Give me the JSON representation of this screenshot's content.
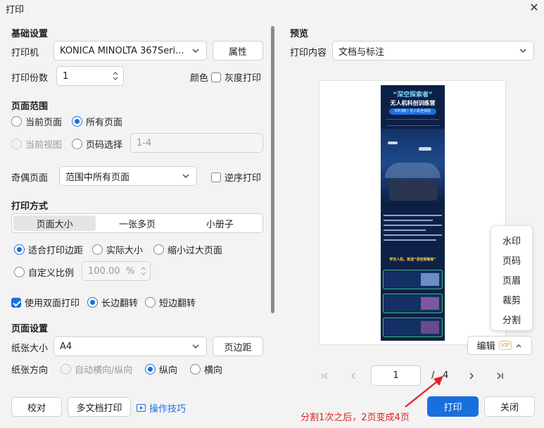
{
  "window": {
    "title": "打印"
  },
  "basic": {
    "section": "基础设置",
    "printer_label": "打印机",
    "printer_value": "KONICA MINOLTA 367Seri...",
    "properties_button": "属性",
    "copies_label": "打印份数",
    "copies_value": "1",
    "color_label": "颜色",
    "grayscale_label": "灰度打印"
  },
  "page_range": {
    "section": "页面范围",
    "current_page": "当前页面",
    "all_pages": "所有页面",
    "current_view": "当前视图",
    "page_select": "页码选择",
    "page_select_value": "1-4",
    "odd_even_label": "奇偶页面",
    "odd_even_value": "范围中所有页面",
    "reverse_label": "逆序打印"
  },
  "print_mode": {
    "section": "打印方式",
    "tabs": [
      "页面大小",
      "一张多页",
      "小册子"
    ],
    "fit_margin": "适合打印边距",
    "actual_size": "实际大小",
    "shrink_large": "缩小过大页面",
    "custom_scale": "自定义比例",
    "custom_scale_value": "100.00",
    "custom_scale_unit": "%",
    "duplex": "使用双面打印",
    "long_edge": "长边翻转",
    "short_edge": "短边翻转"
  },
  "page_setup": {
    "section": "页面设置",
    "paper_size_label": "纸张大小",
    "paper_size_value": "A4",
    "margins_button": "页边距",
    "orientation_label": "纸张方向",
    "auto_orientation": "自动横向/纵向",
    "portrait": "纵向",
    "landscape": "横向"
  },
  "footer": {
    "proofread": "校对",
    "multi_doc": "多文档打印",
    "tips": "操作技巧",
    "print": "打印",
    "close": "关闭"
  },
  "preview": {
    "section": "预览",
    "content_label": "打印内容",
    "content_value": "文档与标注",
    "poster": {
      "title_1": "“深空探索者”",
      "title_2": "无人机科创训练营",
      "badge": "6天3晚丨无人机全体验",
      "slogan": "学无人机，就选“深空探索者”"
    },
    "menu_items": [
      "水印",
      "页码",
      "页眉",
      "裁剪",
      "分割"
    ],
    "edit_button": "编辑",
    "vip_badge": "VIP",
    "current_page": "1",
    "page_separator": "/",
    "total_pages": "4"
  },
  "annotation": {
    "text": "分割1次之后，2页变成4页"
  },
  "colors": {
    "accent": "#1a6fdf",
    "annotation": "#e02020",
    "poster_bg": "#0d2147"
  }
}
